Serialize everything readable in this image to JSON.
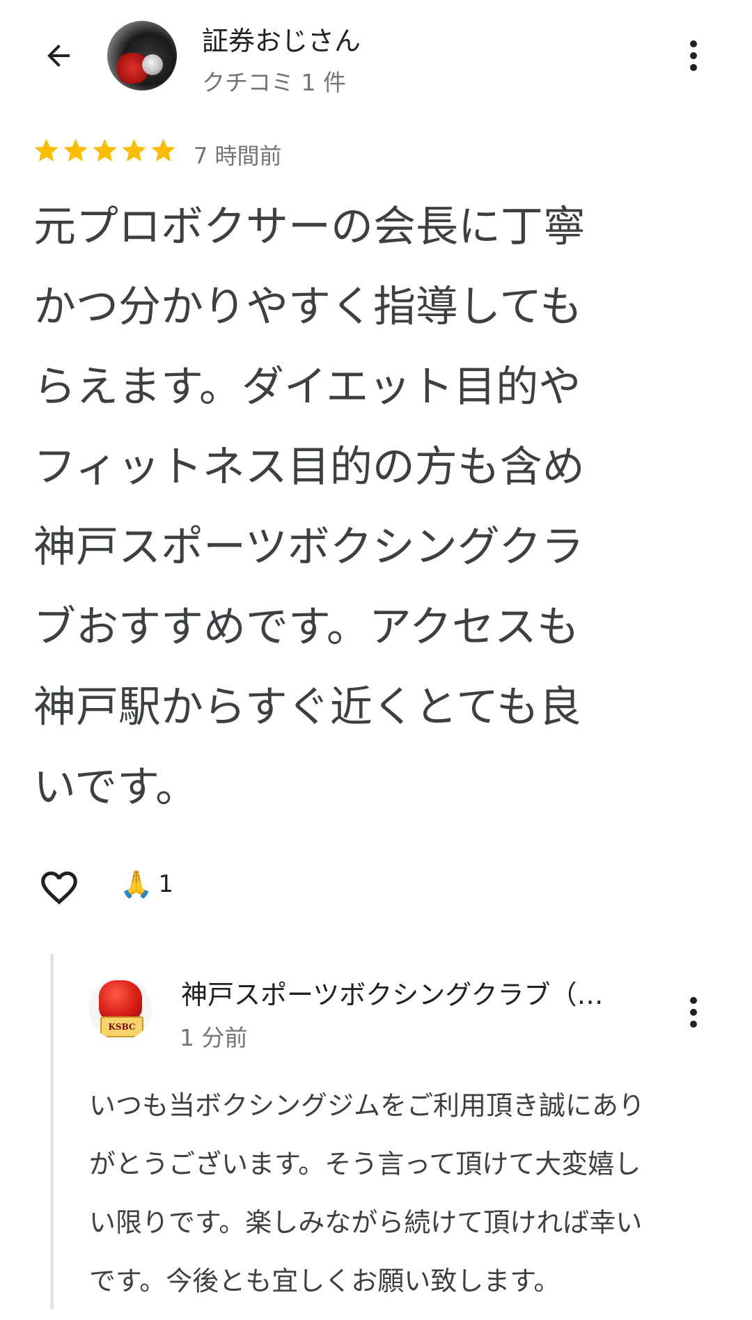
{
  "header": {
    "back_icon": "arrow-left-icon",
    "user_name": "証券おじさん",
    "user_subtitle": "クチコミ 1 件",
    "more_icon": "more-vert-icon"
  },
  "review": {
    "rating": 5,
    "rating_max": 5,
    "star_color": "#fbbc04",
    "time_ago": "7 時間前",
    "text_lines": [
      "元プロボクサーの会長に丁寧",
      "かつ分かりやすく指導しても",
      "らえます。ダイエット目的や",
      "フィットネス目的の方も含め",
      "神戸スポーツボクシングクラ",
      "ブおすすめです。アクセスも",
      "神戸駅からすぐ近くとても良",
      "いです。"
    ]
  },
  "reactions": {
    "like_icon": "heart-outline-icon",
    "emoji": "🙏",
    "count": "1"
  },
  "owner_reply": {
    "name": "神戸スポーツボクシングクラブ（…",
    "time_ago": "1 分前",
    "avatar_badge": "KSBC",
    "more_icon": "more-vert-icon",
    "text_lines": [
      "いつも当ボクシングジムをご利用頂き誠にあり",
      "がとうございます。そう言って頂けて大変嬉し",
      "い限りです。楽しみながら続けて頂ければ幸い",
      "です。今後とも宜しくお願い致します。"
    ]
  }
}
